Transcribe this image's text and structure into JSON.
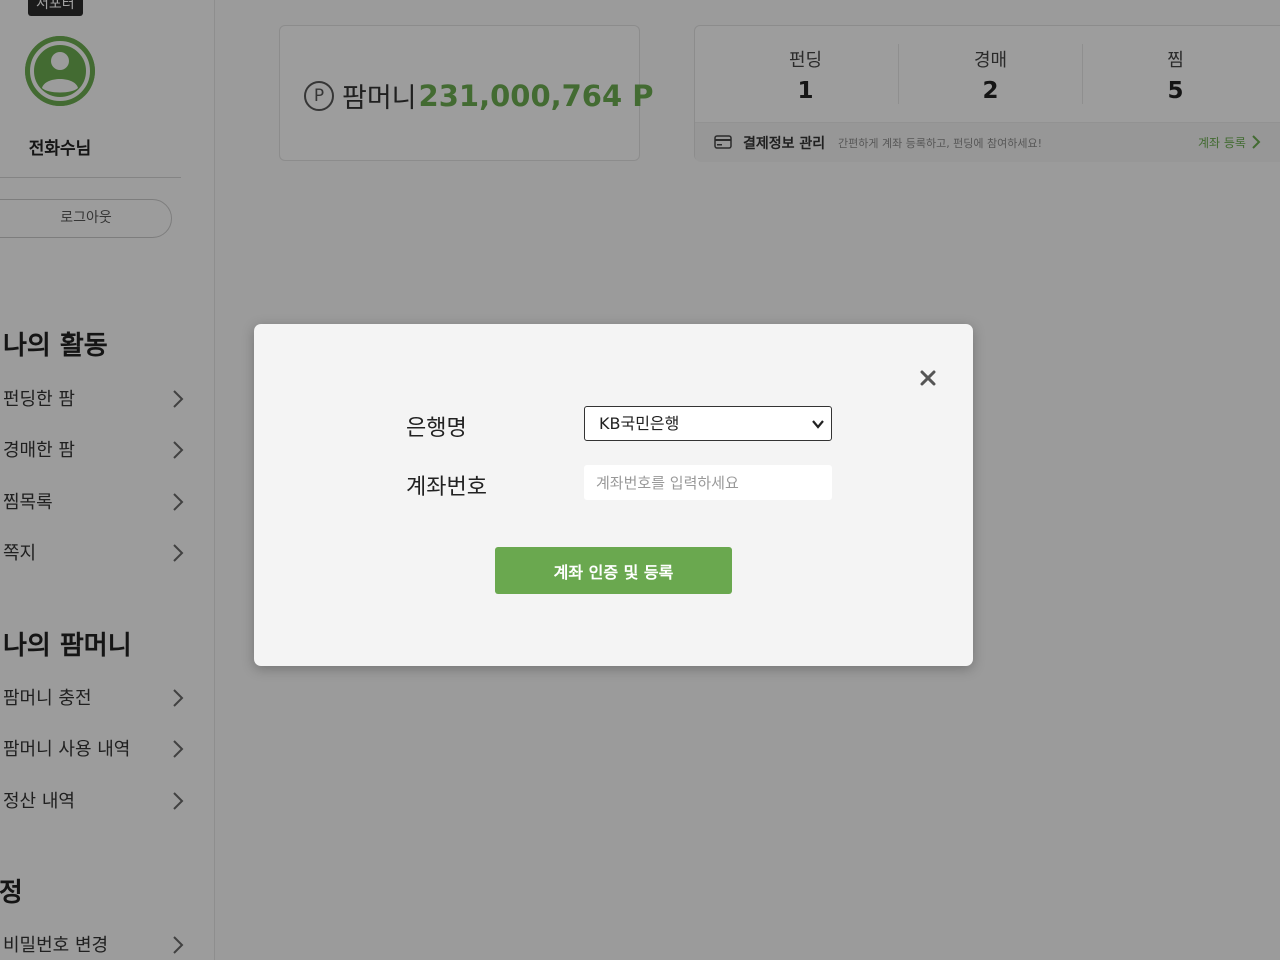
{
  "sidebar": {
    "badge": "서포터",
    "user_name": "전화수님",
    "logout_label": "로그아웃",
    "sections": [
      {
        "title": "나의 활동",
        "items": [
          {
            "label": "펀딩한 팜"
          },
          {
            "label": "경매한 팜"
          },
          {
            "label": "찜목록"
          },
          {
            "label": "쪽지"
          }
        ]
      },
      {
        "title": "나의 팜머니",
        "items": [
          {
            "label": "팜머니 충전"
          },
          {
            "label": "팜머니 사용 내역"
          },
          {
            "label": "정산 내역"
          }
        ]
      },
      {
        "title": "설정",
        "items": [
          {
            "label": "비밀번호 변경"
          }
        ]
      }
    ]
  },
  "money": {
    "icon_letter": "P",
    "label": "팜머니",
    "value": "231,000,764 P"
  },
  "stats": [
    {
      "label": "펀딩",
      "value": "1"
    },
    {
      "label": "경매",
      "value": "2"
    },
    {
      "label": "찜",
      "value": "5"
    }
  ],
  "payment": {
    "title": "결제정보 관리",
    "description": "간편하게 계좌 등록하고, 펀딩에 참여하세요!",
    "link_label": "계좌 등록"
  },
  "modal": {
    "bank_label": "은행명",
    "bank_selected": "KB국민은행",
    "account_label": "계좌번호",
    "account_value": "",
    "account_placeholder": "계좌번호를 입력하세요",
    "submit_label": "계좌 인증 및 등록"
  },
  "colors": {
    "accent": "#6aa84f",
    "overlay": "rgba(0,0,0,0.36)"
  },
  "icons": {
    "avatar": "user-avatar-icon",
    "money": "p-coin-icon",
    "card": "credit-card-icon",
    "chevron": "chevron-right-icon",
    "close": "close-icon",
    "select_arrow": "chevron-down-icon"
  }
}
